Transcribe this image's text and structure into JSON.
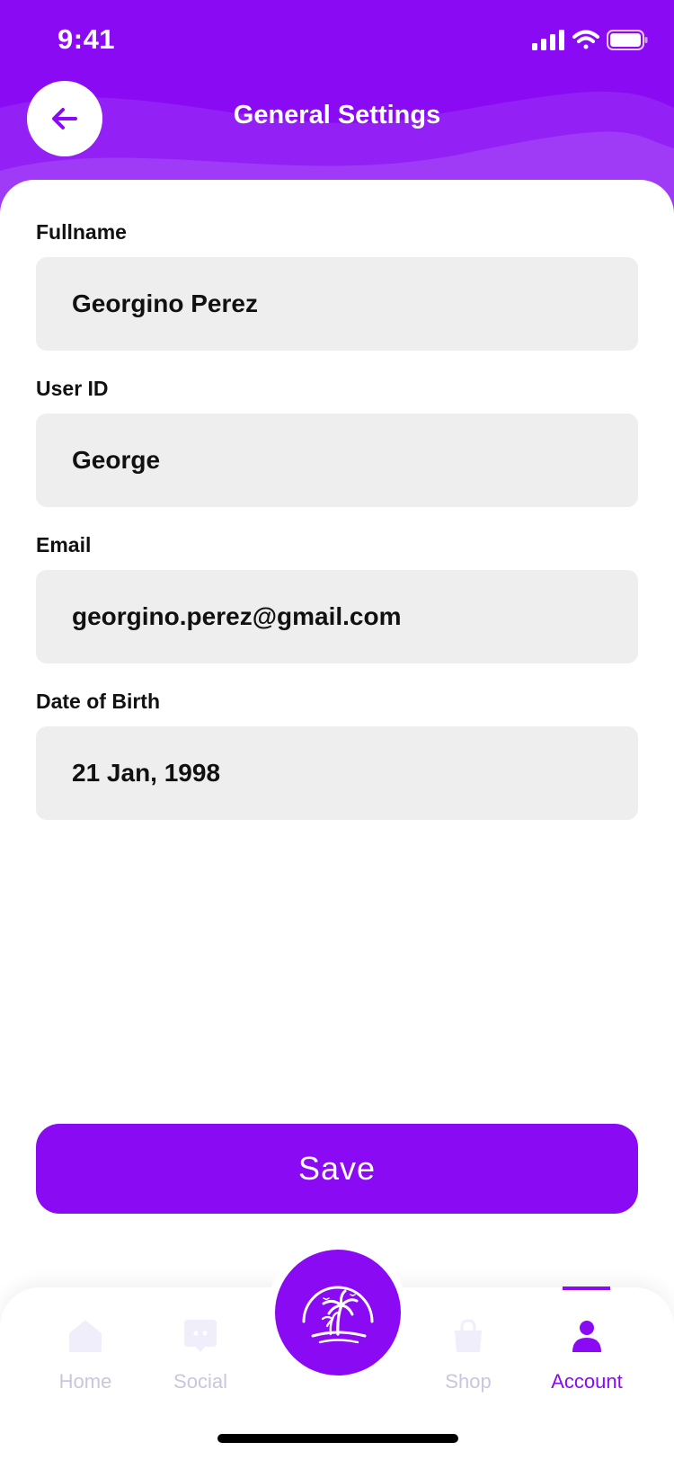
{
  "status_bar": {
    "time": "9:41"
  },
  "header": {
    "title": "General Settings",
    "back_icon": "arrow-left-icon"
  },
  "form": {
    "fields": [
      {
        "label": "Fullname",
        "value": "Georgino Perez"
      },
      {
        "label": "User ID",
        "value": "George"
      },
      {
        "label": "Email",
        "value": "georgino.perez@gmail.com"
      },
      {
        "label": "Date of Birth",
        "value": "21 Jan, 1998"
      }
    ]
  },
  "save_button": {
    "label": "Save"
  },
  "tab_bar": {
    "tabs": [
      {
        "label": "Home",
        "icon": "home-icon",
        "active": false
      },
      {
        "label": "Social",
        "icon": "chat-icon",
        "active": false
      },
      {
        "label": "Shop",
        "icon": "shopping-bag-icon",
        "active": false
      },
      {
        "label": "Account",
        "icon": "user-icon",
        "active": true
      }
    ],
    "center_icon": "palm-tree-island-icon"
  },
  "colors": {
    "accent": "#8a0bf3",
    "field_bg": "#eeeeee",
    "inactive_tab": "#c9c6dd"
  }
}
